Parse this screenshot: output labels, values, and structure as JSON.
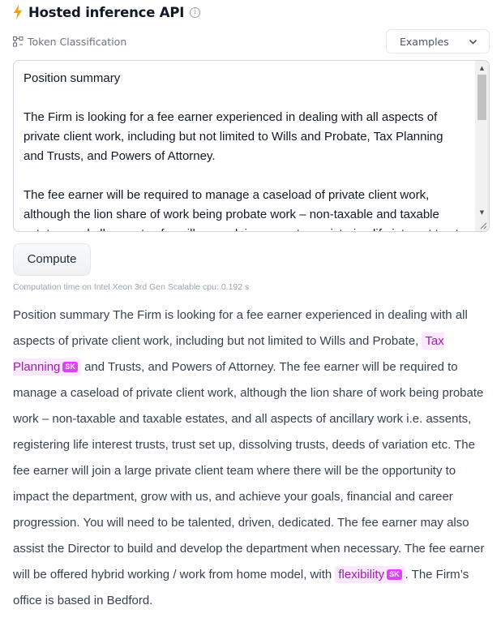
{
  "header": {
    "title": "Hosted inference API",
    "bolt_color": "#f59e0b"
  },
  "task": {
    "label": "Token Classification"
  },
  "examples": {
    "label": "Examples"
  },
  "input": {
    "paragraphs": [
      "Position summary",
      "The Firm is looking for a fee earner experienced in dealing with all aspects of private client work, including but not limited to Wills and Probate, Tax Planning and Trusts, and Powers of Attorney.",
      "The fee earner will be required to manage a caseload of private client work, although the lion share of work being probate work – non-taxable and taxable estates, and all aspects of ancillary work i.e. assents, registering life interest trusts"
    ]
  },
  "compute": {
    "label": "Compute"
  },
  "computation_time": "Computation time on Intel Xeon 3rd Gen Scalable cpu: 0.192 s",
  "output": {
    "segments": [
      {
        "text": "Position summary The Firm is looking for a fee earner experienced in dealing with all aspects of private client work, including but not limited to Wills and Probate, "
      },
      {
        "entity": "Tax Planning",
        "tag": "SK"
      },
      {
        "text": " and Trusts, and Powers of Attorney. The fee earner will be required to manage a caseload of private client work, although the lion share of work being probate work – non-taxable and taxable estates, and all aspects of ancillary work i.e. assents, registering life interest trusts, trust set up, dissolving trusts, deeds of variation etc. The fee earner will join a large private client team where there will be the opportunity to impact the department, grow with us, and achieve your goals, financial and career progression. You will need to be talented, driven, dedicated. The fee earner may also assist the Director to build and develop the department when necessary. The fee earner will be offered hybrid working / work from home model, with "
      },
      {
        "entity": "flexibility",
        "tag": "SK"
      },
      {
        "text": ". The Firm’s office is based in Bedford."
      }
    ],
    "entity_colors": {
      "background": "#fae8ff",
      "text": "#a21caf",
      "tag": "#d946ef"
    }
  }
}
